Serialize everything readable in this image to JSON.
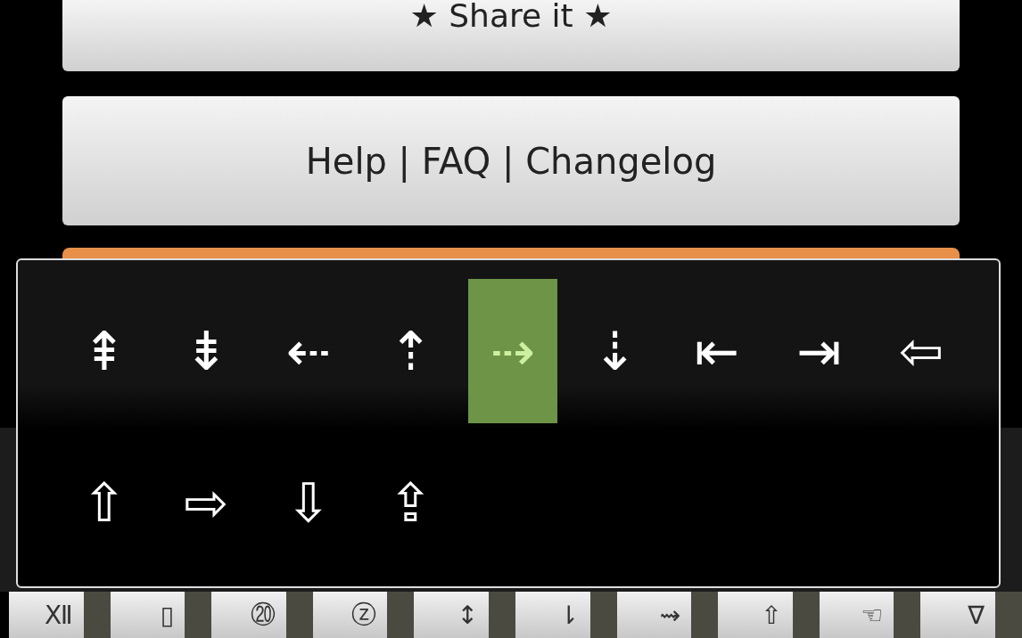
{
  "buttons": [
    {
      "label": "★ Share it ★"
    },
    {
      "label": "Help | FAQ | Changelog"
    }
  ],
  "symbol_picker": {
    "symbols": [
      {
        "label": "⇞",
        "selected": false
      },
      {
        "label": "⇟",
        "selected": false
      },
      {
        "label": "⇠",
        "selected": false
      },
      {
        "label": "⇡",
        "selected": false
      },
      {
        "label": "⇢",
        "selected": true
      },
      {
        "label": "⇣",
        "selected": false
      },
      {
        "label": "⇤",
        "selected": false
      },
      {
        "label": "⇥",
        "selected": false
      },
      {
        "label": "⇦",
        "selected": false
      },
      {
        "label": "⇧",
        "selected": false
      },
      {
        "label": "⇨",
        "selected": false
      },
      {
        "label": "⇩",
        "selected": false
      },
      {
        "label": "⇪",
        "selected": false
      }
    ]
  },
  "candidate_bar": [
    "Ⅻ",
    "▯",
    "⑳",
    "ⓩ",
    "↕",
    "⇂",
    "⇝",
    "⇧",
    "☜",
    "∇"
  ]
}
